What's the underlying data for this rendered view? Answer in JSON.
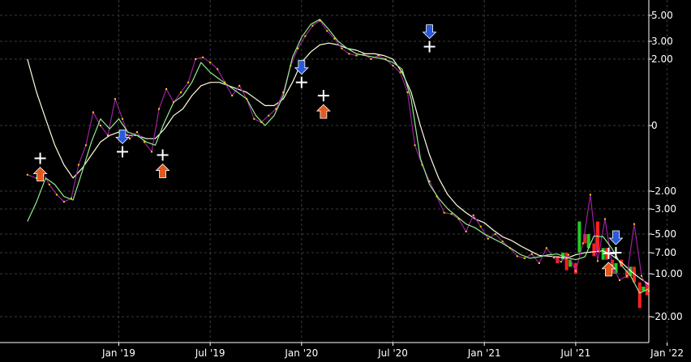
{
  "chart_data": {
    "type": "line",
    "title": "",
    "xlabel": "",
    "ylabel": "",
    "y_scale": "symlog",
    "x_ticks": [
      "Jan '19",
      "Jul '19",
      "Jan '20",
      "Jul '20",
      "Jan '21",
      "Jul '21",
      "Jan '22"
    ],
    "y_ticks": [
      5.0,
      3.0,
      2.0,
      0,
      -2.0,
      -3.0,
      -5.0,
      -7.0,
      -10.0,
      -20.0
    ],
    "y_tick_labels": [
      "5.00",
      "3.00",
      "2.00",
      "0",
      "-2.00",
      "-3.00",
      "-5.00",
      "-7.00",
      "-10.00",
      "-20.00"
    ],
    "grid": true,
    "colors": {
      "background": "#000000",
      "grid": "#3a3a3a",
      "price": "#a020a0",
      "fast_ma": "#90ee90",
      "slow_ma": "#ffffe0",
      "up_bar": "#22cc22",
      "down_bar": "#ff2020",
      "dot": "#ffd700",
      "buy_arrow": "#e05a20",
      "sell_arrow": "#2a5ad8",
      "cross": "#ffffff"
    },
    "price": {
      "name": "",
      "x": [
        0.0,
        0.05,
        0.08,
        0.12,
        0.16,
        0.2,
        0.24,
        0.28,
        0.32,
        0.36,
        0.4,
        0.44,
        0.48,
        0.52,
        0.56,
        0.6,
        0.64,
        0.68,
        0.72,
        0.76,
        0.8,
        0.84,
        0.88,
        0.92,
        0.96,
        1.0,
        1.04,
        1.08,
        1.12,
        1.16,
        1.2,
        1.24,
        1.28,
        1.32,
        1.36,
        1.4,
        1.44,
        1.48,
        1.52,
        1.56,
        1.6,
        1.64,
        1.68,
        1.72,
        1.76,
        1.8,
        1.84,
        1.88,
        1.92,
        1.96,
        2.0,
        2.04,
        2.08,
        2.12,
        2.16,
        2.2,
        2.24,
        2.28,
        2.32,
        2.36,
        2.4,
        2.44,
        2.48,
        2.52,
        2.56,
        2.6,
        2.64,
        2.68,
        2.72,
        2.76,
        2.8,
        2.84,
        2.88,
        2.92,
        2.96,
        3.0,
        3.04,
        3.08,
        3.12,
        3.16,
        3.2,
        3.24,
        3.28,
        3.32,
        3.36,
        3.4
      ],
      "y": [
        -1.5,
        -1.6,
        -1.4,
        -1.8,
        -2.2,
        -2.6,
        -2.4,
        -1.2,
        -0.6,
        0.4,
        0.0,
        -0.3,
        0.8,
        0.2,
        -0.4,
        -0.2,
        -0.5,
        -0.8,
        0.5,
        1.1,
        0.7,
        1.0,
        1.3,
        2.0,
        2.1,
        1.9,
        1.7,
        1.3,
        0.9,
        1.2,
        0.8,
        0.2,
        0.1,
        0.3,
        0.5,
        1.0,
        1.8,
        2.6,
        3.4,
        4.2,
        4.6,
        3.8,
        3.2,
        2.6,
        2.3,
        2.2,
        2.3,
        2.0,
        2.2,
        2.0,
        1.8,
        1.6,
        1.0,
        -0.6,
        -1.2,
        -1.7,
        -2.3,
        -3.3,
        -3.4,
        -3.8,
        -4.8,
        -3.5,
        -4.4,
        -5.5,
        -5.0,
        -5.8,
        -6.5,
        -7.5,
        -7.8,
        -7.2,
        -8.5,
        -6.5,
        -7.7,
        -8.3,
        -7.3,
        -9.6,
        -6.0,
        -2.2,
        -8.2,
        -3.8,
        -8.8,
        -11.5,
        -10.5,
        -4.2,
        -10.5,
        -14.0
      ]
    },
    "fast_ma": {
      "name": "",
      "x": [
        0.0,
        0.05,
        0.1,
        0.15,
        0.2,
        0.25,
        0.3,
        0.35,
        0.4,
        0.45,
        0.5,
        0.55,
        0.6,
        0.65,
        0.7,
        0.75,
        0.8,
        0.85,
        0.9,
        0.95,
        1.0,
        1.05,
        1.1,
        1.15,
        1.2,
        1.25,
        1.3,
        1.35,
        1.4,
        1.45,
        1.5,
        1.55,
        1.6,
        1.65,
        1.7,
        1.75,
        1.8,
        1.85,
        1.9,
        1.95,
        2.0,
        2.05,
        2.1,
        2.15,
        2.2,
        2.25,
        2.3,
        2.35,
        2.4,
        2.45,
        2.5,
        2.55,
        2.6,
        2.65,
        2.7,
        2.75,
        2.8,
        2.85,
        2.9,
        2.95,
        3.0,
        3.05,
        3.1,
        3.15,
        3.2,
        3.25,
        3.3,
        3.35,
        3.4
      ],
      "y": [
        -4.0,
        -2.6,
        -1.6,
        -1.8,
        -2.3,
        -2.5,
        -1.4,
        -0.5,
        0.2,
        -0.1,
        0.2,
        -0.2,
        -0.3,
        -0.5,
        -0.6,
        0.1,
        0.7,
        0.9,
        1.3,
        1.9,
        1.6,
        1.4,
        1.2,
        1.0,
        0.8,
        0.3,
        0.0,
        0.3,
        0.9,
        2.1,
        3.3,
        4.3,
        4.7,
        3.9,
        3.0,
        2.6,
        2.3,
        2.2,
        2.1,
        2.0,
        1.9,
        1.7,
        0.8,
        -1.0,
        -1.8,
        -2.4,
        -3.0,
        -3.6,
        -4.2,
        -4.5,
        -5.0,
        -5.5,
        -6.0,
        -6.6,
        -7.3,
        -7.8,
        -7.6,
        -7.3,
        -7.2,
        -7.7,
        -8.0,
        -7.6,
        -5.2,
        -5.3,
        -6.6,
        -8.8,
        -10.5,
        -14.5,
        -13.5
      ]
    },
    "slow_ma": {
      "name": "",
      "x": [
        0.0,
        0.05,
        0.1,
        0.15,
        0.2,
        0.25,
        0.3,
        0.35,
        0.4,
        0.45,
        0.5,
        0.55,
        0.6,
        0.65,
        0.7,
        0.75,
        0.8,
        0.85,
        0.9,
        0.95,
        1.0,
        1.05,
        1.1,
        1.15,
        1.2,
        1.25,
        1.3,
        1.35,
        1.4,
        1.45,
        1.5,
        1.55,
        1.6,
        1.65,
        1.7,
        1.75,
        1.8,
        1.85,
        1.9,
        1.95,
        2.0,
        2.05,
        2.1,
        2.15,
        2.2,
        2.25,
        2.3,
        2.35,
        2.4,
        2.45,
        2.5,
        2.55,
        2.6,
        2.65,
        2.7,
        2.75,
        2.8,
        2.85,
        2.9,
        2.95,
        3.0,
        3.05,
        3.1,
        3.15,
        3.2,
        3.25,
        3.3,
        3.35,
        3.4
      ],
      "y": [
        2.0,
        1.0,
        0.2,
        -0.6,
        -1.2,
        -1.6,
        -1.3,
        -0.9,
        -0.5,
        -0.3,
        -0.2,
        -0.3,
        -0.3,
        -0.4,
        -0.4,
        -0.1,
        0.3,
        0.5,
        0.9,
        1.2,
        1.3,
        1.3,
        1.2,
        1.1,
        1.0,
        0.8,
        0.6,
        0.6,
        0.8,
        1.3,
        1.9,
        2.4,
        2.8,
        2.9,
        2.8,
        2.6,
        2.5,
        2.3,
        2.3,
        2.2,
        2.0,
        1.6,
        1.0,
        0.0,
        -0.9,
        -1.6,
        -2.2,
        -2.8,
        -3.3,
        -3.8,
        -4.1,
        -4.7,
        -5.3,
        -5.7,
        -6.3,
        -6.8,
        -7.4,
        -7.5,
        -7.6,
        -7.8,
        -7.3,
        -7.0,
        -6.9,
        -6.8,
        -7.4,
        -8.4,
        -9.6,
        -11.0,
        -12.5
      ]
    },
    "bars": {
      "x": [
        2.9,
        2.93,
        2.95,
        2.97,
        3.0,
        3.02,
        3.05,
        3.07,
        3.1,
        3.12,
        3.15,
        3.17,
        3.2,
        3.22,
        3.25,
        3.28,
        3.3,
        3.32,
        3.35,
        3.37,
        3.39
      ],
      "open": [
        -7.5,
        -8.0,
        -7.0,
        -9.0,
        -8.5,
        -7.0,
        -5.0,
        -6.5,
        -6.0,
        -4.0,
        -8.0,
        -6.5,
        -8.0,
        -10.0,
        -8.0,
        -9.5,
        -10.5,
        -9.0,
        -12.0,
        -14.0,
        -12.0
      ],
      "close": [
        -8.5,
        -7.0,
        -9.5,
        -8.0,
        -10.0,
        -4.0,
        -6.0,
        -5.0,
        -7.5,
        -7.0,
        -6.5,
        -8.0,
        -10.0,
        -8.5,
        -9.0,
        -11.0,
        -9.0,
        -12.0,
        -18.0,
        -13.0,
        -15.0
      ]
    },
    "signals": [
      {
        "type": "buy",
        "x": 0.07,
        "y": -1.0
      },
      {
        "type": "sell",
        "x": 0.52,
        "y": -0.8
      },
      {
        "type": "buy",
        "x": 0.74,
        "y": -0.9
      },
      {
        "type": "sell",
        "x": 1.5,
        "y": 1.3
      },
      {
        "type": "buy",
        "x": 1.62,
        "y": 0.9
      },
      {
        "type": "sell",
        "x": 2.2,
        "y": 2.7
      },
      {
        "type": "buy",
        "x": 3.18,
        "y": -7.1
      },
      {
        "type": "sell",
        "x": 3.22,
        "y": -7.0
      }
    ]
  }
}
